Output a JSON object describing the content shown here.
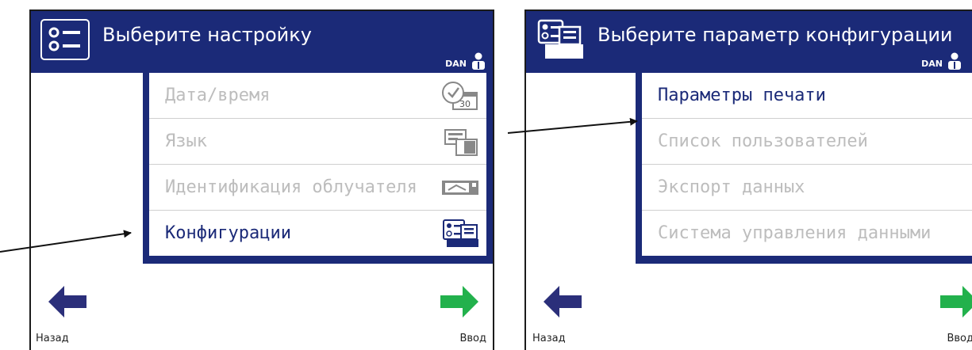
{
  "left": {
    "title": "Выберите настройку",
    "user": "DAN",
    "menu": [
      {
        "label": "Дата/время",
        "icon": "calendar-clock-icon",
        "state": "disabled"
      },
      {
        "label": "Язык",
        "icon": "language-icon",
        "state": "disabled"
      },
      {
        "label": "Идентификация облучателя",
        "icon": "irradiator-icon",
        "state": "disabled"
      },
      {
        "label": "Конфигурации",
        "icon": "configuration-icon",
        "state": "active"
      }
    ],
    "calendar_day": "30",
    "back_label": "Назад",
    "enter_label": "Ввод"
  },
  "right": {
    "title": "Выберите параметр конфигурации",
    "user": "DAN",
    "menu": [
      {
        "label": "Параметры печати",
        "state": "active"
      },
      {
        "label": "Список пользователей",
        "state": "disabled"
      },
      {
        "label": "Экспорт данных",
        "state": "disabled"
      },
      {
        "label": "Система управления данными",
        "state": "disabled"
      }
    ],
    "back_label": "Назад",
    "enter_label": "Ввод"
  },
  "colors": {
    "header": "#1b2a78",
    "active_text": "#1b2a78",
    "disabled_text": "#bdbdbd",
    "back_arrow": "#2b2f7a",
    "enter_arrow": "#22b14c"
  }
}
